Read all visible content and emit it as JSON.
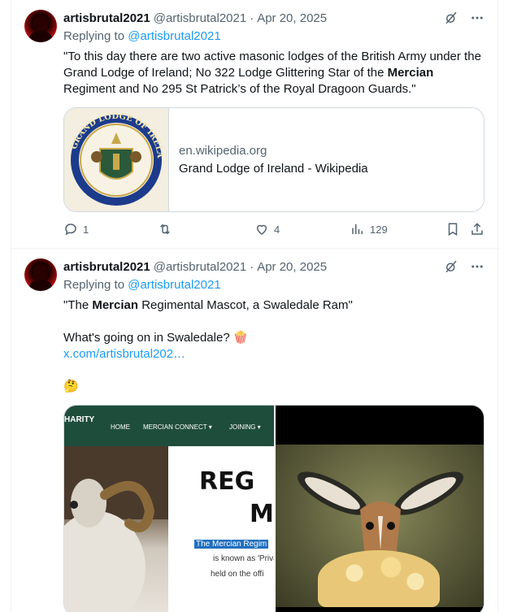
{
  "tweets": [
    {
      "author": {
        "name": "artisbrutal2021",
        "handle": "@artisbrutal2021",
        "date": "Apr 20, 2025"
      },
      "replying_prefix": "Replying to",
      "replying_to": "@artisbrutal2021",
      "text": {
        "part1": "\"To this day there are two active masonic lodges of the British Army  under the Grand Lodge of Ireland; No 322 Lodge Glittering Star of the ",
        "bold": "Mercian",
        "part2": " Regiment and No 295 St Patrick’s of the Royal Dragoon Guards.\""
      },
      "card": {
        "domain": "en.wikipedia.org",
        "title": "Grand Lodge of Ireland - Wikipedia",
        "seal_text": "GRAND LODGE OF IRELAND"
      },
      "actions": {
        "replies": "1",
        "reposts": "",
        "likes": "4",
        "views": "129"
      }
    },
    {
      "author": {
        "name": "artisbrutal2021",
        "handle": "@artisbrutal2021",
        "date": "Apr 20, 2025"
      },
      "replying_prefix": "Replying to",
      "replying_to": "@artisbrutal2021",
      "text": {
        "line1_pre": "\"The ",
        "line1_bold": "Mercian",
        "line1_post": " Regimental Mascot, a Swaledale Ram\"",
        "line2": "What's going on in Swaledale? 🍿",
        "link": "x.com/artisbrutal202…",
        "emoji": "🤔"
      },
      "media": {
        "left": {
          "brand": "HARITY",
          "nav": [
            "HOME",
            "MERCIAN CONNECT ▾",
            "JOINING ▾"
          ],
          "title1": "REG",
          "title2": "M",
          "highlight": "The Mercian Regim",
          "line1": "is known as 'Priva",
          "line2": "held on the offi"
        }
      }
    }
  ],
  "colors": {
    "accent": "#1d9bf0",
    "muted": "#536471",
    "text": "#0f1419",
    "border": "#cfd9de"
  }
}
